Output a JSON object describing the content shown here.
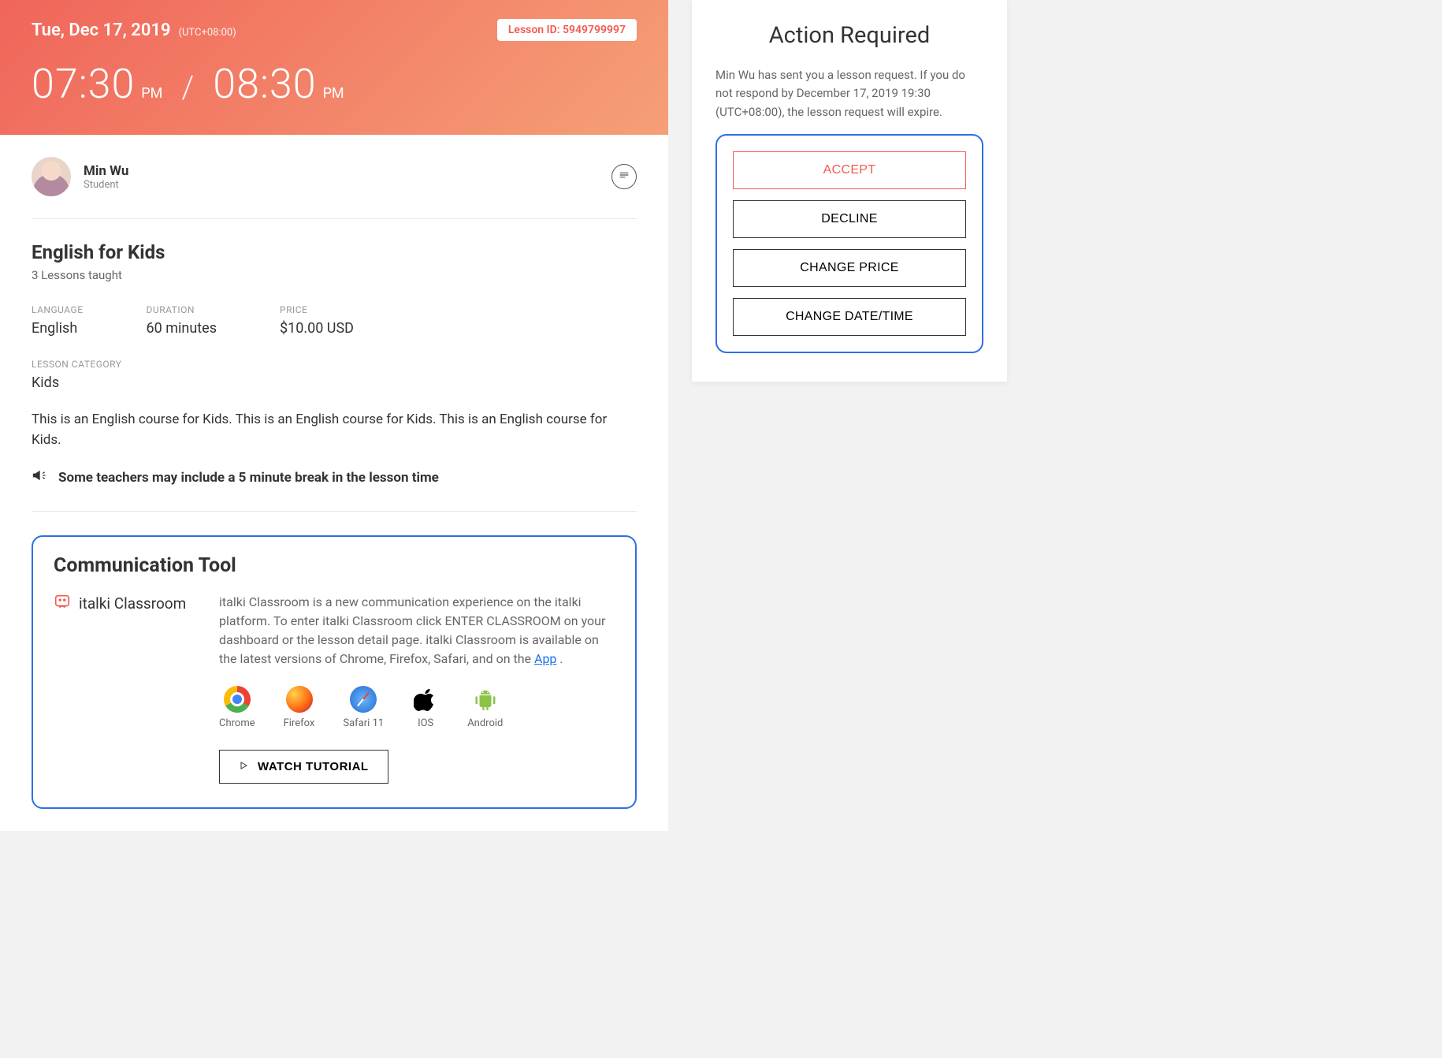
{
  "hero": {
    "date": "Tue, Dec 17, 2019",
    "tz": "(UTC+08:00)",
    "lesson_id_label": "Lesson ID: 5949799997",
    "start_time": "07:30",
    "start_ampm": "PM",
    "end_time": "08:30",
    "end_ampm": "PM"
  },
  "student": {
    "name": "Min Wu",
    "role": "Student"
  },
  "course": {
    "title": "English for Kids",
    "taught": "3 Lessons taught",
    "language_label": "LANGUAGE",
    "language": "English",
    "duration_label": "DURATION",
    "duration": "60 minutes",
    "price_label": "PRICE",
    "price": "$10.00 USD",
    "category_label": "LESSON CATEGORY",
    "category": "Kids",
    "description": "This is an English course for Kids. This is an English course for Kids. This is an English course for Kids.",
    "note": "Some teachers may include a 5 minute break in the lesson time"
  },
  "comm": {
    "heading": "Communication Tool",
    "tool_name": "italki Classroom",
    "desc_prefix": "italki Classroom is a new communication experience on the italki platform. To enter italki Classroom click ENTER CLASSROOM on your dashboard or the lesson detail page. italki Classroom is available on the latest versions of Chrome, Firefox, Safari, and on the ",
    "app_link": "App",
    "desc_suffix": " .",
    "platforms": [
      "Chrome",
      "Firefox",
      "Safari 11",
      "IOS",
      "Android"
    ],
    "watch_label": "WATCH TUTORIAL"
  },
  "sidebar": {
    "title": "Action Required",
    "desc": "Min Wu has sent you a lesson request. If you do not respond by December 17, 2019 19:30 (UTC+08:00), the lesson request will expire.",
    "accept": "ACCEPT",
    "decline": "DECLINE",
    "change_price": "CHANGE PRICE",
    "change_time": "CHANGE DATE/TIME"
  }
}
